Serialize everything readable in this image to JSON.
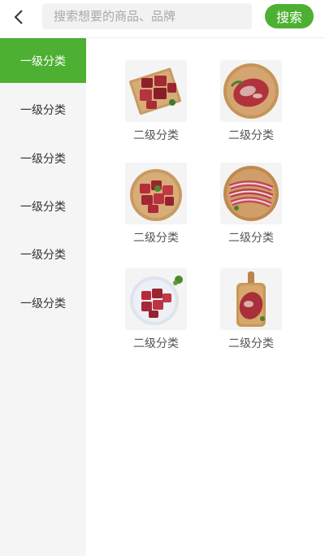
{
  "header": {
    "search_placeholder": "搜索想要的商品、品牌",
    "search_label": "搜索",
    "back_icon": "chevron-left-icon"
  },
  "sidebar": {
    "items": [
      {
        "label": "一级分类",
        "active": true
      },
      {
        "label": "一级分类",
        "active": false
      },
      {
        "label": "一级分类",
        "active": false
      },
      {
        "label": "一级分类",
        "active": false
      },
      {
        "label": "一级分类",
        "active": false
      },
      {
        "label": "一级分类",
        "active": false
      }
    ]
  },
  "grid": {
    "items": [
      {
        "label": "二级分类",
        "image": "beef-cubes-on-board"
      },
      {
        "label": "二级分类",
        "image": "steak-on-board"
      },
      {
        "label": "二级分类",
        "image": "beef-cubes-in-bowl"
      },
      {
        "label": "二级分类",
        "image": "sliced-meat-on-plate"
      },
      {
        "label": "二级分类",
        "image": "beef-cubes-on-plate"
      },
      {
        "label": "二级分类",
        "image": "steak-on-paddle"
      }
    ]
  },
  "colors": {
    "accent": "#4eb032",
    "sidebar_bg": "#f5f5f5"
  }
}
